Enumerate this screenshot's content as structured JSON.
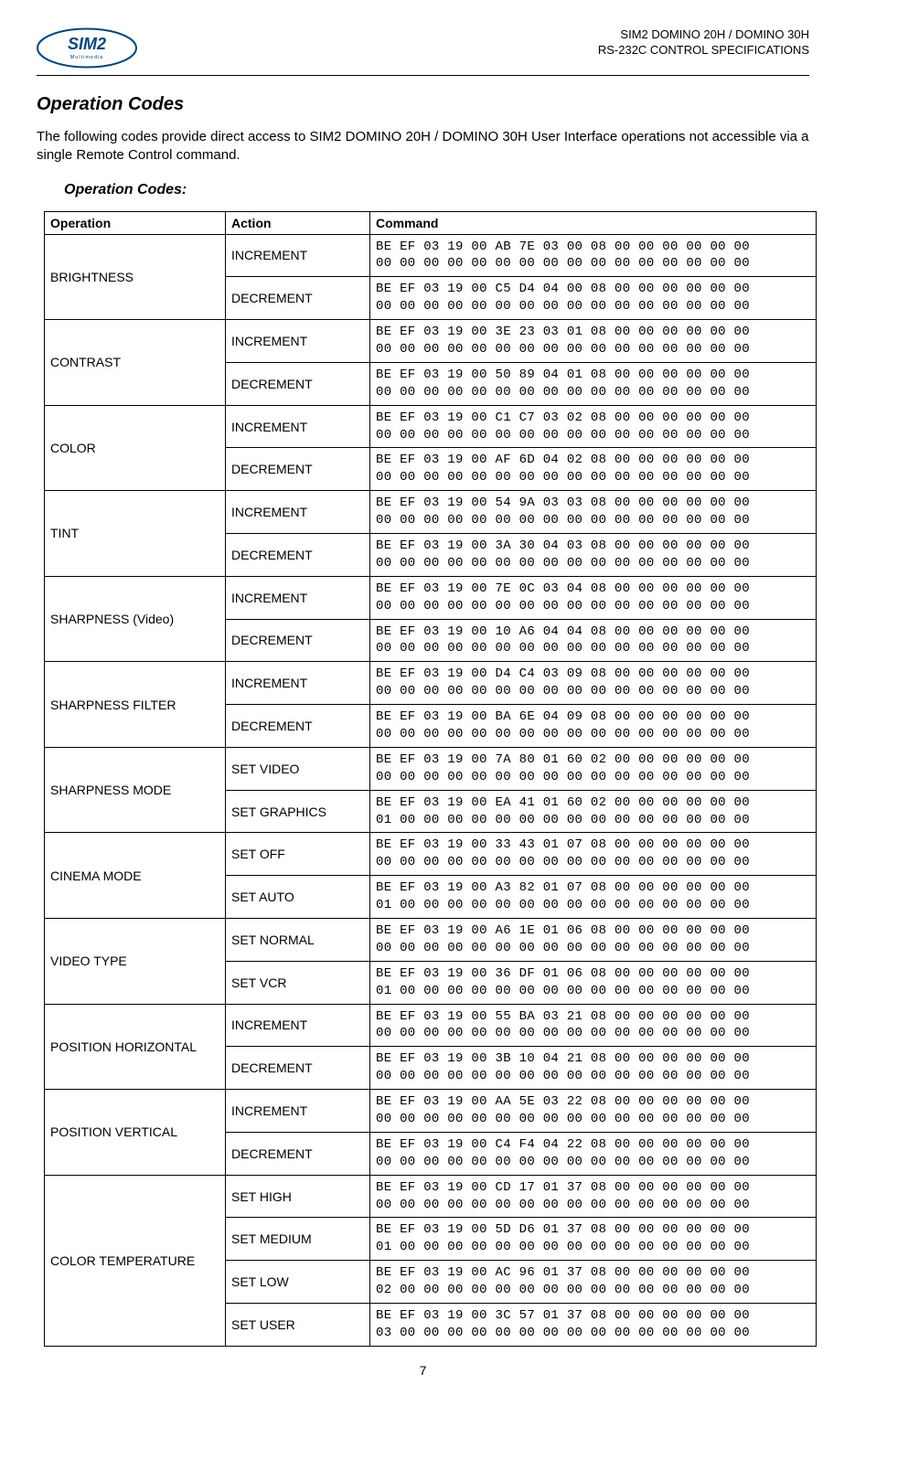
{
  "header": {
    "line1": "SIM2 DOMINO 20H / DOMINO 30H",
    "line2": "RS-232C CONTROL SPECIFICATIONS"
  },
  "section_title": "Operation Codes",
  "intro": "The following codes provide direct access to SIM2 DOMINO 20H / DOMINO 30H User Interface operations not accessible via a single Remote Control command.",
  "subheading": "Operation Codes:",
  "table_headers": {
    "operation": "Operation",
    "action": "Action",
    "command": "Command"
  },
  "rows": [
    {
      "operation": "BRIGHTNESS",
      "actions": [
        {
          "action": "INCREMENT",
          "command": "BE EF 03 19 00 AB 7E 03 00 08 00 00 00 00 00 00\n00 00 00 00 00 00 00 00 00 00 00 00 00 00 00 00"
        },
        {
          "action": "DECREMENT",
          "command": "BE EF 03 19 00 C5 D4 04 00 08 00 00 00 00 00 00\n00 00 00 00 00 00 00 00 00 00 00 00 00 00 00 00"
        }
      ]
    },
    {
      "operation": "CONTRAST",
      "actions": [
        {
          "action": "INCREMENT",
          "command": "BE EF 03 19 00 3E 23 03 01 08 00 00 00 00 00 00\n00 00 00 00 00 00 00 00 00 00 00 00 00 00 00 00"
        },
        {
          "action": "DECREMENT",
          "command": "BE EF 03 19 00 50 89 04 01 08 00 00 00 00 00 00\n00 00 00 00 00 00 00 00 00 00 00 00 00 00 00 00"
        }
      ]
    },
    {
      "operation": "COLOR",
      "actions": [
        {
          "action": "INCREMENT",
          "command": "BE EF 03 19 00 C1 C7 03 02 08 00 00 00 00 00 00\n00 00 00 00 00 00 00 00 00 00 00 00 00 00 00 00"
        },
        {
          "action": "DECREMENT",
          "command": "BE EF 03 19 00 AF 6D 04 02 08 00 00 00 00 00 00\n00 00 00 00 00 00 00 00 00 00 00 00 00 00 00 00"
        }
      ]
    },
    {
      "operation": "TINT",
      "actions": [
        {
          "action": "INCREMENT",
          "command": "BE EF 03 19 00 54 9A 03 03 08 00 00 00 00 00 00\n00 00 00 00 00 00 00 00 00 00 00 00 00 00 00 00"
        },
        {
          "action": "DECREMENT",
          "command": "BE EF 03 19 00 3A 30 04 03 08 00 00 00 00 00 00\n00 00 00 00 00 00 00 00 00 00 00 00 00 00 00 00"
        }
      ]
    },
    {
      "operation": "SHARPNESS (Video)",
      "actions": [
        {
          "action": "INCREMENT",
          "command": "BE EF 03 19 00 7E 0C 03 04 08 00 00 00 00 00 00\n00 00 00 00 00 00 00 00 00 00 00 00 00 00 00 00"
        },
        {
          "action": "DECREMENT",
          "command": "BE EF 03 19 00 10 A6 04 04 08 00 00 00 00 00 00\n00 00 00 00 00 00 00 00 00 00 00 00 00 00 00 00"
        }
      ]
    },
    {
      "operation": "SHARPNESS FILTER",
      "actions": [
        {
          "action": "INCREMENT",
          "command": "BE EF 03 19 00 D4 C4 03 09 08 00 00 00 00 00 00\n00 00 00 00 00 00 00 00 00 00 00 00 00 00 00 00"
        },
        {
          "action": "DECREMENT",
          "command": "BE EF 03 19 00 BA 6E 04 09 08 00 00 00 00 00 00\n00 00 00 00 00 00 00 00 00 00 00 00 00 00 00 00"
        }
      ]
    },
    {
      "operation": "SHARPNESS MODE",
      "actions": [
        {
          "action": "SET VIDEO",
          "command": "BE EF 03 19 00 7A 80 01 60 02 00 00 00 00 00 00\n00 00 00 00 00 00 00 00 00 00 00 00 00 00 00 00"
        },
        {
          "action": "SET GRAPHICS",
          "command": "BE EF 03 19 00 EA 41 01 60 02 00 00 00 00 00 00\n01 00 00 00 00 00 00 00 00 00 00 00 00 00 00 00"
        }
      ]
    },
    {
      "operation": "CINEMA MODE",
      "actions": [
        {
          "action": "SET OFF",
          "command": "BE EF 03 19 00 33 43 01 07 08 00 00 00 00 00 00\n00 00 00 00 00 00 00 00 00 00 00 00 00 00 00 00"
        },
        {
          "action": "SET AUTO",
          "command": "BE EF 03 19 00 A3 82 01 07 08 00 00 00 00 00 00\n01 00 00 00 00 00 00 00 00 00 00 00 00 00 00 00"
        }
      ]
    },
    {
      "operation": "VIDEO TYPE",
      "actions": [
        {
          "action": "SET NORMAL",
          "command": "BE EF 03 19 00 A6 1E 01 06 08 00 00 00 00 00 00\n00 00 00 00 00 00 00 00 00 00 00 00 00 00 00 00"
        },
        {
          "action": "SET VCR",
          "command": "BE EF 03 19 00 36 DF 01 06 08 00 00 00 00 00 00\n01 00 00 00 00 00 00 00 00 00 00 00 00 00 00 00"
        }
      ]
    },
    {
      "operation": "POSITION HORIZONTAL",
      "actions": [
        {
          "action": "INCREMENT",
          "command": "BE EF 03 19 00 55 BA 03 21 08 00 00 00 00 00 00\n00 00 00 00 00 00 00 00 00 00 00 00 00 00 00 00"
        },
        {
          "action": "DECREMENT",
          "command": "BE EF 03 19 00 3B 10 04 21 08 00 00 00 00 00 00\n00 00 00 00 00 00 00 00 00 00 00 00 00 00 00 00"
        }
      ]
    },
    {
      "operation": "POSITION VERTICAL",
      "actions": [
        {
          "action": "INCREMENT",
          "command": "BE EF 03 19 00 AA 5E 03 22 08 00 00 00 00 00 00\n00 00 00 00 00 00 00 00 00 00 00 00 00 00 00 00"
        },
        {
          "action": "DECREMENT",
          "command": "BE EF 03 19 00 C4 F4 04 22 08 00 00 00 00 00 00\n00 00 00 00 00 00 00 00 00 00 00 00 00 00 00 00"
        }
      ]
    },
    {
      "operation": "COLOR TEMPERATURE",
      "actions": [
        {
          "action": "SET HIGH",
          "command": "BE EF 03 19 00 CD 17 01 37 08 00 00 00 00 00 00\n00 00 00 00 00 00 00 00 00 00 00 00 00 00 00 00"
        },
        {
          "action": "SET MEDIUM",
          "command": "BE EF 03 19 00 5D D6 01 37 08 00 00 00 00 00 00\n01 00 00 00 00 00 00 00 00 00 00 00 00 00 00 00"
        },
        {
          "action": "SET LOW",
          "command": "BE EF 03 19 00 AC 96 01 37 08 00 00 00 00 00 00\n02 00 00 00 00 00 00 00 00 00 00 00 00 00 00 00"
        },
        {
          "action": "SET USER",
          "command": "BE EF 03 19 00 3C 57 01 37 08 00 00 00 00 00 00\n03 00 00 00 00 00 00 00 00 00 00 00 00 00 00 00"
        }
      ]
    }
  ],
  "page_number": "7"
}
